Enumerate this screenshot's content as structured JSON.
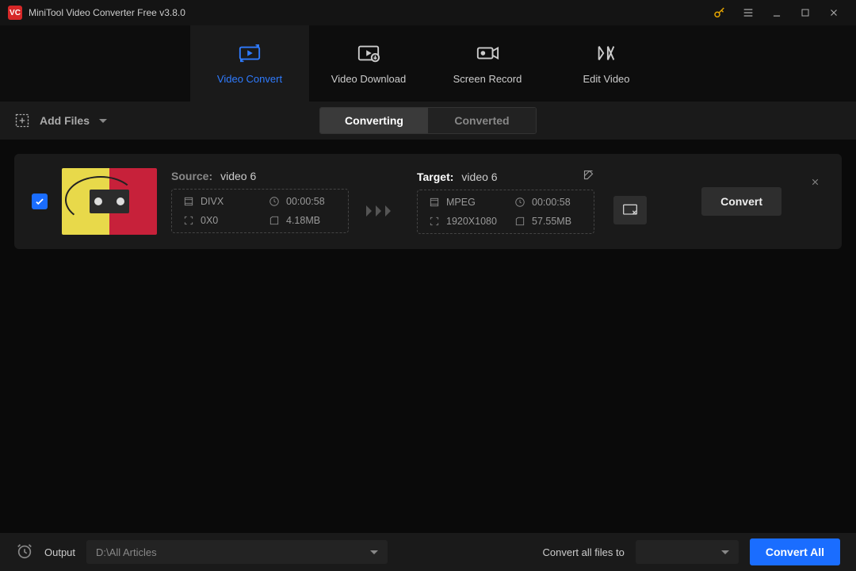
{
  "titlebar": {
    "app_icon_text": "VC",
    "title": "MiniTool Video Converter Free v3.8.0"
  },
  "maintabs": {
    "convert": "Video Convert",
    "download": "Video Download",
    "record": "Screen Record",
    "edit": "Edit Video"
  },
  "toolbar": {
    "add_files": "Add Files",
    "subtabs": {
      "converting": "Converting",
      "converted": "Converted"
    }
  },
  "item": {
    "source_label": "Source:",
    "source_name": "video 6",
    "target_label": "Target:",
    "target_name": "video 6",
    "src": {
      "format": "DIVX",
      "duration": "00:00:58",
      "resolution": "0X0",
      "size": "4.18MB"
    },
    "tgt": {
      "format": "MPEG",
      "duration": "00:00:58",
      "resolution": "1920X1080",
      "size": "57.55MB"
    },
    "convert_btn": "Convert"
  },
  "bottombar": {
    "output_label": "Output",
    "output_path": "D:\\All Articles",
    "convert_all_label": "Convert all files to",
    "convert_all_btn": "Convert All"
  }
}
